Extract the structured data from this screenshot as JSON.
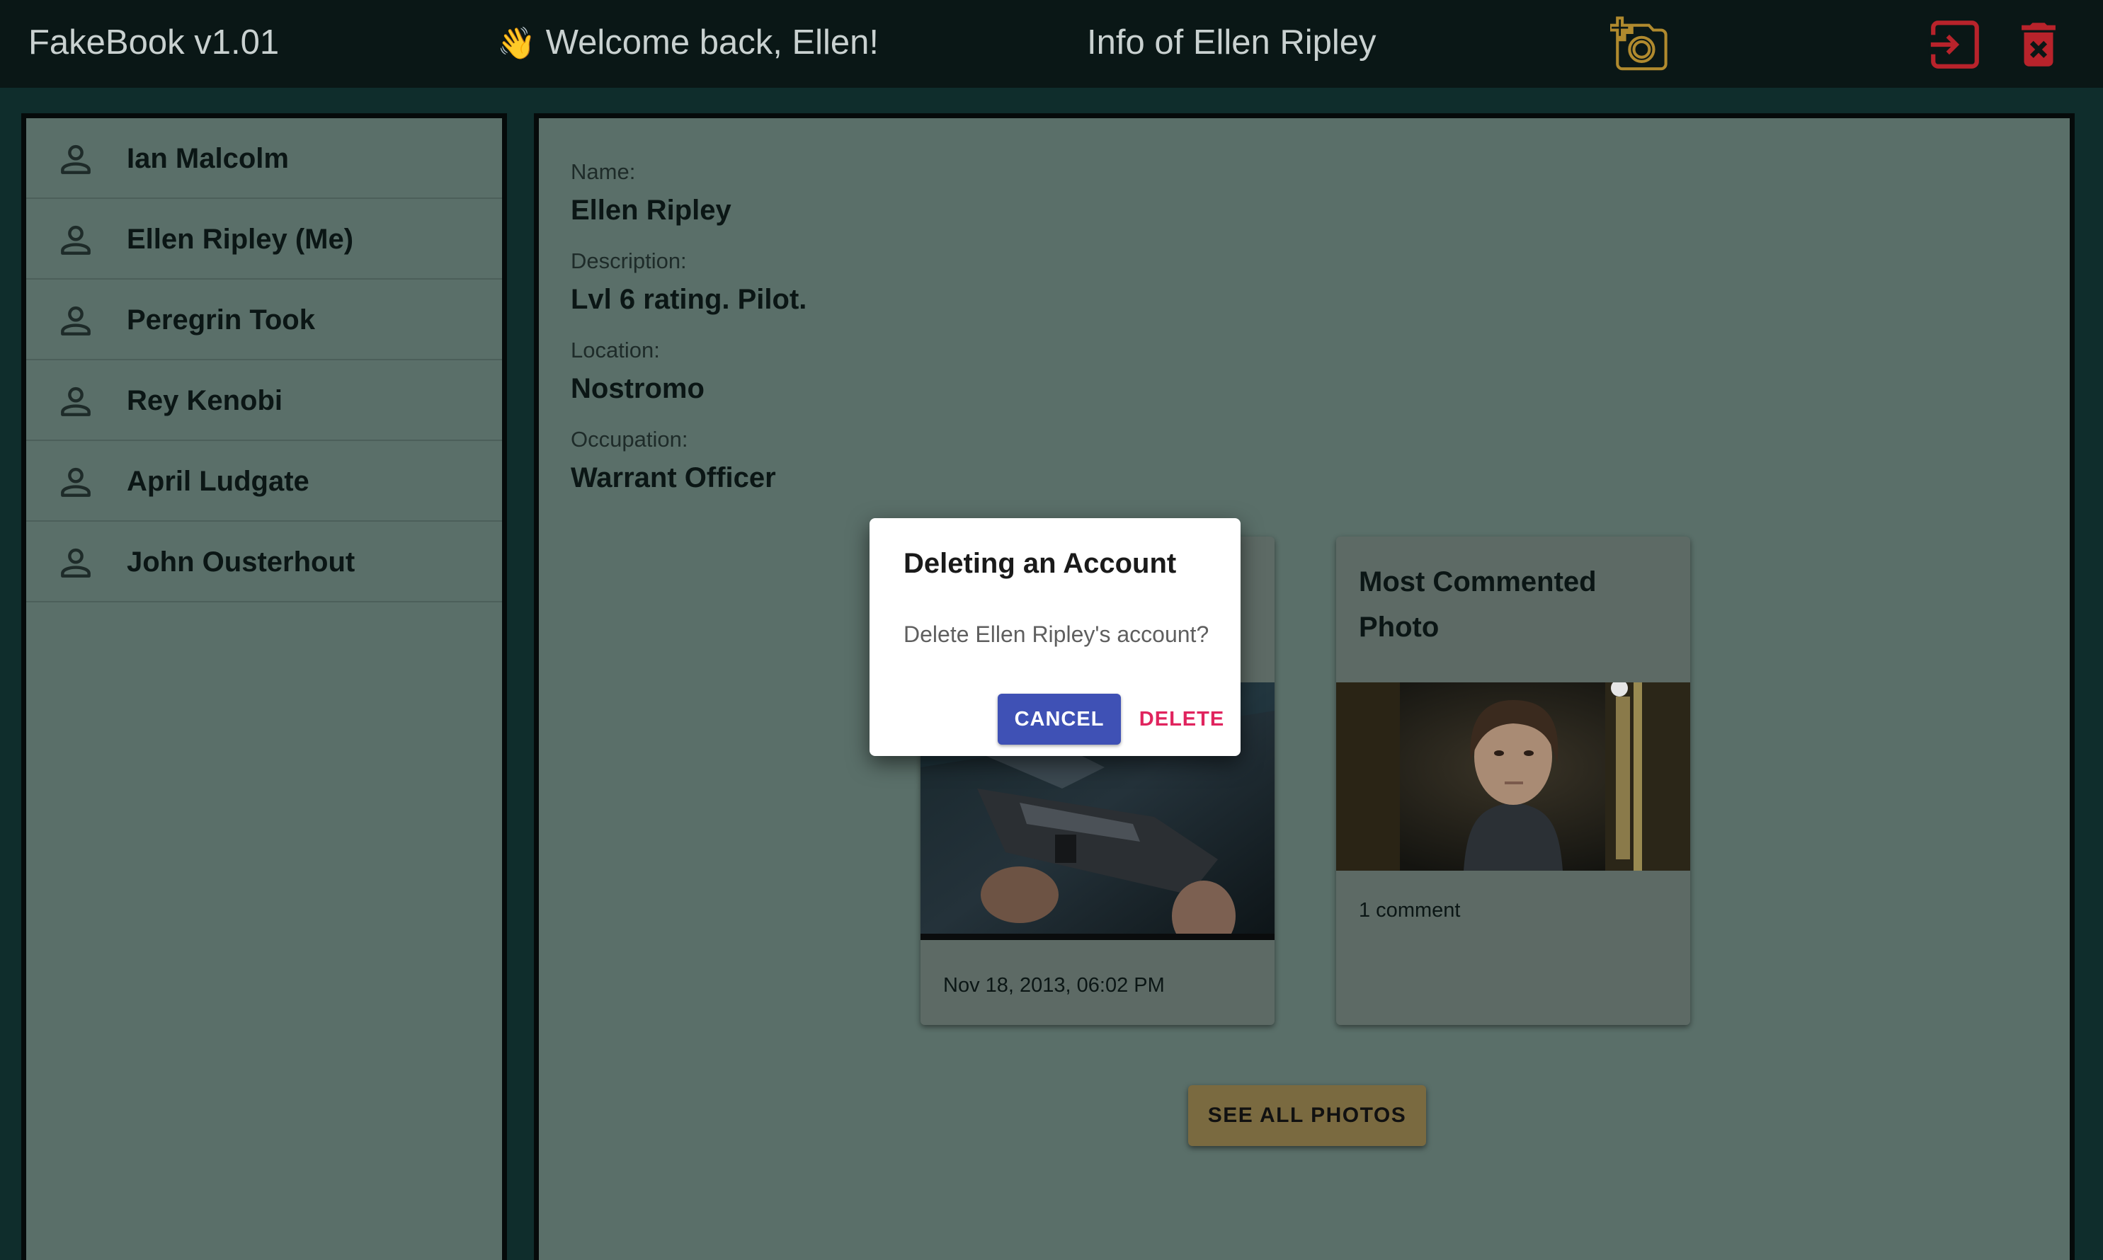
{
  "appbar": {
    "brand": "FakeBook v1.01",
    "wave_emoji": "👋",
    "welcome": "Welcome back, Ellen!",
    "context_title": "Info of Ellen Ripley",
    "icons": [
      "add-photo-icon",
      "logout-icon",
      "delete-account-icon"
    ],
    "colors": {
      "background": "#0a1716",
      "text": "#c9d1d0",
      "add_photo": "#b08a2e",
      "logout": "#b8232b",
      "delete": "#b8232b"
    }
  },
  "sidebar": {
    "users": [
      {
        "name": "Ian Malcolm"
      },
      {
        "name": "Ellen Ripley (Me)"
      },
      {
        "name": "Peregrin Took"
      },
      {
        "name": "Rey Kenobi"
      },
      {
        "name": "April Ludgate"
      },
      {
        "name": "John Ousterhout"
      }
    ],
    "item_icon": "person-icon"
  },
  "profile": {
    "name_label": "Name:",
    "name": "Ellen Ripley",
    "description_label": "Description:",
    "description": "Lvl 6 rating. Pilot.",
    "location_label": "Location:",
    "location": "Nostromo",
    "occupation_label": "Occupation:",
    "occupation": "Warrant Officer"
  },
  "cards": {
    "recent": {
      "date": "Nov 18, 2013, 06:02 PM"
    },
    "most_commented": {
      "title": "Most Commented Photo",
      "comments": "1 comment"
    }
  },
  "see_all_label": "SEE ALL PHOTOS",
  "dialog": {
    "title": "Deleting an Account",
    "message": "Delete Ellen Ripley's account?",
    "cancel_label": "CANCEL",
    "delete_label": "DELETE",
    "colors": {
      "cancel_bg": "#3f51b5",
      "delete_text": "#e0245e"
    }
  }
}
